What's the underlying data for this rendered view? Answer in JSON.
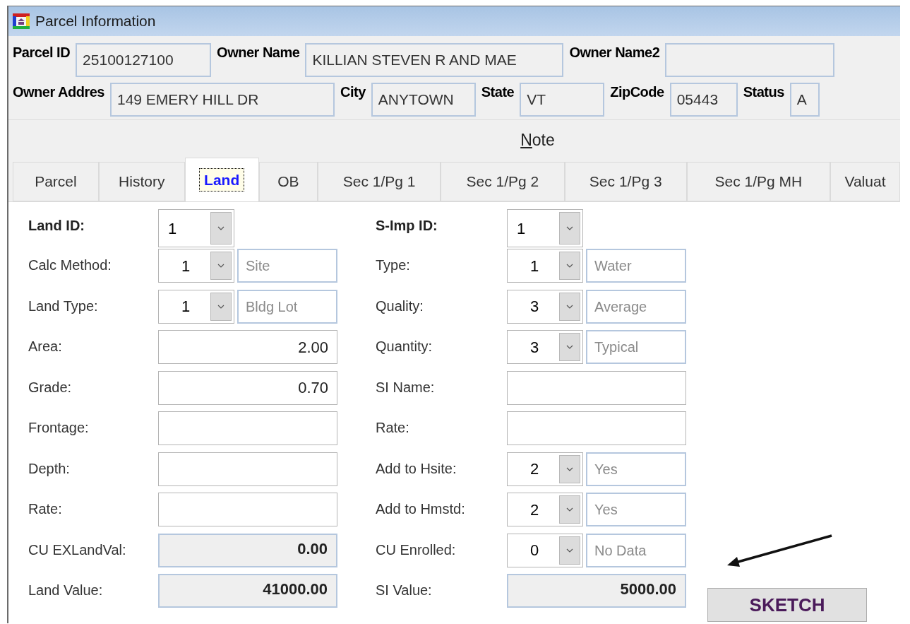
{
  "window": {
    "title": "Parcel Information"
  },
  "owner_line": [
    {
      "label": "Parcel ID",
      "value": "25100127100"
    },
    {
      "label": "Owner Name",
      "value": "KILLIAN STEVEN R AND MAE"
    },
    {
      "label": "Owner Name2"
    }
  ],
  "address_line": [
    {
      "label": "Owner Addres",
      "value": "149 EMERY HILL DR"
    },
    {
      "label": "City",
      "value": "ANYTOWN"
    },
    {
      "label": "State",
      "value": "VT"
    },
    {
      "label": "ZipCode",
      "value": "05443"
    },
    {
      "label": "Status",
      "value": "A"
    }
  ],
  "note_button": {
    "label": "Note"
  },
  "tabs": [
    {
      "label": "Parcel",
      "selected": false
    },
    {
      "label": "History",
      "selected": false
    },
    {
      "label": "Land",
      "selected": true
    },
    {
      "label": "OB",
      "selected": false
    },
    {
      "label": "Sec 1/Pg 1",
      "selected": false
    },
    {
      "label": "Sec 1/Pg 2",
      "selected": false
    },
    {
      "label": "Sec 1/Pg 3",
      "selected": false
    },
    {
      "label": "Sec 1/Pg MH",
      "selected": false
    },
    {
      "label": "Valuat",
      "selected": false
    }
  ],
  "land": [
    {
      "kind": "id",
      "label": "Land ID:",
      "value": "1"
    },
    {
      "kind": "combo",
      "label": "Calc Method:",
      "value": "1",
      "description": "Site"
    },
    {
      "kind": "combo",
      "label": "Land Type:",
      "value": "1",
      "description": "Bldg Lot"
    },
    {
      "kind": "text",
      "label": "Area:",
      "value": "2.00"
    },
    {
      "kind": "text",
      "label": "Grade:",
      "value": "0.70"
    },
    {
      "kind": "text",
      "label": "Frontage:"
    },
    {
      "kind": "text",
      "label": "Depth:"
    },
    {
      "kind": "text",
      "label": "Rate:"
    },
    {
      "kind": "readonly",
      "label": "CU EXLandVal:",
      "value": "0.00"
    },
    {
      "kind": "readonly",
      "label": "Land Value:",
      "value": "41000.00"
    }
  ],
  "improvement": [
    {
      "kind": "id",
      "label": "S-Imp ID:",
      "value": "1"
    },
    {
      "kind": "combo",
      "label": "Type:",
      "value": "1",
      "description": "Water"
    },
    {
      "kind": "combo",
      "label": "Quality:",
      "value": "3",
      "description": "Average"
    },
    {
      "kind": "combo",
      "label": "Quantity:",
      "value": "3",
      "description": "Typical"
    },
    {
      "kind": "text",
      "label": "SI Name:"
    },
    {
      "kind": "text",
      "label": "Rate:"
    },
    {
      "kind": "combo",
      "label": "Add to Hsite:",
      "value": "2",
      "description": "Yes"
    },
    {
      "kind": "combo",
      "label": "Add to Hmstd:",
      "value": "2",
      "description": "Yes"
    },
    {
      "kind": "combo",
      "label": "CU Enrolled:",
      "value": "0",
      "description": "No Data"
    },
    {
      "kind": "readonly",
      "label": "SI Value:",
      "value": "5000.00"
    }
  ],
  "sketch_button": {
    "label": "SKETCH"
  }
}
